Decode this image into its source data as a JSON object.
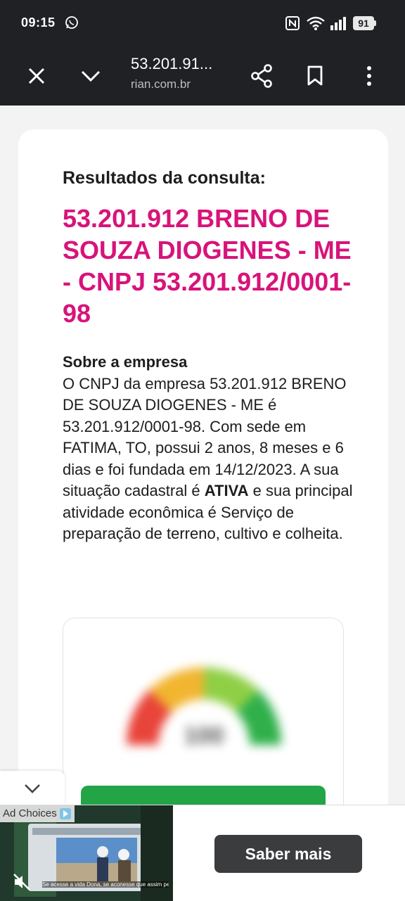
{
  "status_bar": {
    "time": "09:15",
    "battery": "91"
  },
  "toolbar": {
    "title": "53.201.91...",
    "url": "rian.com.br"
  },
  "page": {
    "results_heading": "Resultados da consulta:",
    "company_title": "53.201.912 BRENO DE SOUZA DIOGENES - ME - CNPJ 53.201.912/0001-98",
    "about_heading": "Sobre a empresa",
    "about_text_before": "O CNPJ da empresa 53.201.912 BRENO DE SOUZA DIOGENES - ME é 53.201.912/0001-98. Com sede em FATIMA, TO, possui 2 anos, 8 meses e 6 dias e foi fundada em 14/12/2023. A sua situação cadastral é ",
    "status_bold": "ATIVA",
    "about_text_after": " e sua principal atividade econômica é Serviço de preparação de terreno, cultivo e colheita.",
    "gauge_value": "100"
  },
  "ad": {
    "choices_label": "Ad Choices",
    "caption": "Se acesse a vida Dona, se aconesse que assim pela o última vez!",
    "cta_label": "Saber mais"
  },
  "colors": {
    "brand_magenta": "#d8137a",
    "button_green": "#22a447",
    "toolbar_dark": "#202124"
  }
}
